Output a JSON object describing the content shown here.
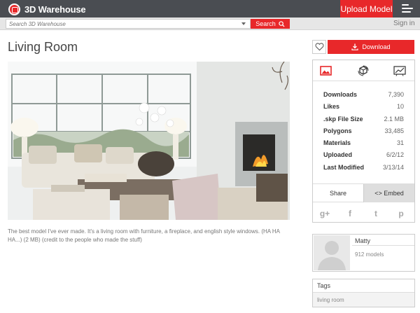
{
  "header": {
    "brand": "3D Warehouse",
    "upload_label": "Upload Model"
  },
  "search": {
    "placeholder": "Search 3D Warehouse",
    "button_label": "Search",
    "signin_label": "Sign in"
  },
  "model": {
    "title": "Living Room",
    "description": "The best model I've ever made. It's a living room with furniture, a fireplace, and english style windows. (HA HA HA...) (2 MB) (credit to the people who made the stuff)",
    "download_label": "Download"
  },
  "stats": [
    {
      "label": "Downloads",
      "value": "7,390"
    },
    {
      "label": "Likes",
      "value": "10"
    },
    {
      "label": ".skp File Size",
      "value": "2.1 MB"
    },
    {
      "label": "Polygons",
      "value": "33,485"
    },
    {
      "label": "Materials",
      "value": "31"
    },
    {
      "label": "Uploaded",
      "value": "6/2/12"
    },
    {
      "label": "Last Modified",
      "value": "3/13/14"
    }
  ],
  "share": {
    "share_label": "Share",
    "embed_label": "<> Embed",
    "social": [
      {
        "icon": "google-plus-icon",
        "glyph": "g+"
      },
      {
        "icon": "facebook-icon",
        "glyph": "f"
      },
      {
        "icon": "twitter-icon",
        "glyph": "t"
      },
      {
        "icon": "pinterest-icon",
        "glyph": "p"
      }
    ]
  },
  "author": {
    "name": "Matty",
    "models": "912 models"
  },
  "tags": {
    "title": "Tags",
    "items": [
      "living room"
    ]
  },
  "colors": {
    "accent": "#e8282a",
    "topbar": "#4a4d52"
  }
}
